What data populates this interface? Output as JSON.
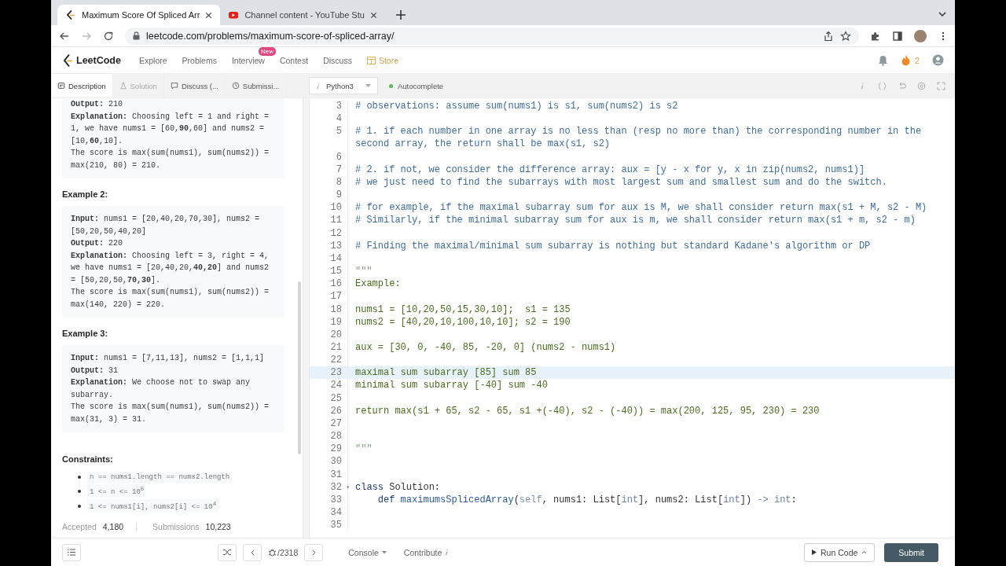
{
  "browser": {
    "tabs": [
      {
        "title": "Maximum Score Of Spliced Arr",
        "kind": "leetcode",
        "selected": true
      },
      {
        "title": "Channel content - YouTube Stu",
        "kind": "youtube",
        "selected": false
      }
    ],
    "url": "leetcode.com/problems/maximum-score-of-spliced-array/"
  },
  "nav": {
    "brand": "LeetCode",
    "items": [
      {
        "label": "Explore",
        "kind": "link"
      },
      {
        "label": "Problems",
        "kind": "link"
      },
      {
        "label": "Interview",
        "kind": "link",
        "badge": "New"
      },
      {
        "label": "Contest",
        "kind": "link"
      },
      {
        "label": "Discuss",
        "kind": "link"
      },
      {
        "label": "Store",
        "kind": "store"
      }
    ],
    "streak": "2"
  },
  "panel_tabs": [
    {
      "label": "Description",
      "kind": "description",
      "selected": true,
      "disabled": false
    },
    {
      "label": "Solution",
      "kind": "solution",
      "selected": false,
      "disabled": true
    },
    {
      "label": "Discuss (...",
      "kind": "discuss",
      "selected": false,
      "disabled": false
    },
    {
      "label": "Submissi...",
      "kind": "submissions",
      "selected": false,
      "disabled": false
    }
  ],
  "editor_toolbar": {
    "language": "Python3",
    "autocomplete": {
      "label": "Autocomplete",
      "on": true
    }
  },
  "description": {
    "examples": [
      {
        "paragraphs": [
          "**Output:** 210",
          "**Explanation:** Choosing left = 1 and right = 1, we have nums1 = [60,**90**,60] and nums2 = [10,**60**,10].",
          "The score is max(sum(nums1), sum(nums2)) = max(210, 80) = 210."
        ]
      },
      {
        "heading": "Example 2:",
        "paragraphs": [
          "**Input:** nums1 = [20,40,20,70,30], nums2 = [50,20,50,40,20]",
          "**Output:** 220",
          "**Explanation:** Choosing left = 3, right = 4, we have nums1 = [20,40,20,**40,20**] and nums2 = [50,20,50,**70,30**].",
          "The score is max(sum(nums1), sum(nums2)) = max(140, 220) = 220."
        ]
      },
      {
        "heading": "Example 3:",
        "paragraphs": [
          "**Input:** nums1 = [7,11,13], nums2 = [1,1,1]",
          "**Output:** 31",
          "**Explanation:** We choose not to swap any subarray.",
          "The score is max(sum(nums1), sum(nums2)) = max(31, 3) = 31."
        ]
      }
    ],
    "constraints_heading": "Constraints:",
    "constraints": [
      "n == nums1.length == nums2.length",
      "1 <= n <= 10$^{5}$",
      "1 <= nums1[i], nums2[i] <= 10$^{4}$"
    ],
    "stats": [
      {
        "label": "Accepted",
        "value": "4,180"
      },
      {
        "label": "Submissions",
        "value": "10,223"
      }
    ]
  },
  "code": {
    "lines": [
      {
        "number": "3",
        "highlighted": false,
        "tokens": [
          {
            "text": "# observations: assume sum(nums1) is s1, sum(nums2) is s2",
            "kind": "comment"
          }
        ]
      },
      {
        "number": "4",
        "highlighted": false
      },
      {
        "number": "5",
        "highlighted": false,
        "tokens": [
          {
            "text": "# 1. if each number in one array is no less than (resp no more than) the corresponding number in the second array, the return shall be max(s1, s2)",
            "kind": "comment"
          }
        ]
      },
      {
        "number": "6",
        "highlighted": false
      },
      {
        "number": "7",
        "highlighted": false,
        "tokens": [
          {
            "text": "# 2. if not, we consider the difference array: aux = [y - x for y, x in zip(nums2, nums1)]",
            "kind": "comment"
          }
        ]
      },
      {
        "number": "8",
        "highlighted": false,
        "tokens": [
          {
            "text": "# we just need to find the subarrays with most largest sum and smallest sum and do the switch.",
            "kind": "comment"
          }
        ]
      },
      {
        "number": "9",
        "highlighted": false
      },
      {
        "number": "10",
        "highlighted": false,
        "tokens": [
          {
            "text": "# for example, if the maximal subarray sum for aux is M, we shall consider return max(s1 + M, s2 - M)",
            "kind": "comment"
          }
        ]
      },
      {
        "number": "11",
        "highlighted": false,
        "tokens": [
          {
            "text": "# Similarly, if the minimal subarray sum for aux is m, we shall consider return max(s1 + m, s2 - m)",
            "kind": "comment"
          }
        ]
      },
      {
        "number": "12",
        "highlighted": false
      },
      {
        "number": "13",
        "highlighted": false,
        "tokens": [
          {
            "text": "# Finding the maximal/minimal sum subarray is nothing but standard Kadane's algorithm or DP",
            "kind": "comment"
          }
        ]
      },
      {
        "number": "14",
        "highlighted": false
      },
      {
        "number": "15",
        "highlighted": false,
        "tokens": [
          {
            "text": "\"\"\"",
            "kind": "quote"
          }
        ]
      },
      {
        "number": "16",
        "highlighted": false,
        "tokens": [
          {
            "text": "Example:",
            "kind": "string"
          }
        ]
      },
      {
        "number": "17",
        "highlighted": false
      },
      {
        "number": "18",
        "highlighted": false,
        "tokens": [
          {
            "text": "nums1 = [10,20,50,15,30,10];  s1 = 135",
            "kind": "string"
          }
        ]
      },
      {
        "number": "19",
        "highlighted": false,
        "tokens": [
          {
            "text": "nums2 = [40,20,10,100,10,10]; s2 = 190",
            "kind": "string"
          }
        ]
      },
      {
        "number": "20",
        "highlighted": false
      },
      {
        "number": "21",
        "highlighted": false,
        "tokens": [
          {
            "text": "aux = [30, 0, -40, 85, -20, 0] (nums2 - nums1)",
            "kind": "string"
          }
        ]
      },
      {
        "number": "22",
        "highlighted": false
      },
      {
        "number": "23",
        "highlighted": true,
        "tokens": [
          {
            "text": "maximal sum subarray [85] sum 85",
            "kind": "string"
          }
        ]
      },
      {
        "number": "24",
        "highlighted": false,
        "tokens": [
          {
            "text": "minimal sum subarray [-40] sum -40",
            "kind": "string"
          }
        ]
      },
      {
        "number": "25",
        "highlighted": false
      },
      {
        "number": "26",
        "highlighted": false,
        "tokens": [
          {
            "text": "return max(s1 + 65, s2 - 65, s1 +(-40), s2 - (-40)) = max(200, 125, 95, 230) = 230",
            "kind": "string"
          }
        ]
      },
      {
        "number": "27",
        "highlighted": false
      },
      {
        "number": "28",
        "highlighted": false
      },
      {
        "number": "29",
        "highlighted": false,
        "tokens": [
          {
            "text": "\"\"\"",
            "kind": "quote"
          }
        ]
      },
      {
        "number": "30",
        "highlighted": false
      },
      {
        "number": "31",
        "highlighted": false
      },
      {
        "number": "32",
        "highlighted": false,
        "fold_marker": "▾",
        "tokens": [
          {
            "text": "class",
            "kind": "keyword"
          },
          {
            "text": " Solution:",
            "kind": "plain"
          }
        ]
      },
      {
        "number": "33",
        "highlighted": false,
        "tokens": [
          {
            "text": "    def",
            "kind": "keyword"
          },
          {
            "text": " maximumsSplicedArray",
            "kind": "function"
          },
          {
            "text": "(",
            "kind": "plain"
          },
          {
            "text": "self",
            "kind": "self"
          },
          {
            "text": ", nums1: List[",
            "kind": "plain"
          },
          {
            "text": "int",
            "kind": "type"
          },
          {
            "text": "], nums2: List[",
            "kind": "plain"
          },
          {
            "text": "int",
            "kind": "type"
          },
          {
            "text": "]) ",
            "kind": "plain"
          },
          {
            "text": "-> int",
            "kind": "type"
          },
          {
            "text": ":",
            "kind": "plain"
          }
        ]
      },
      {
        "number": "34",
        "highlighted": false
      },
      {
        "number": "35",
        "highlighted": false
      }
    ]
  },
  "bottom_bar": {
    "problem_counter": "/2318",
    "console": "Console",
    "contribute": "Contribute",
    "run": "Run Code",
    "submit": "Submit"
  }
}
